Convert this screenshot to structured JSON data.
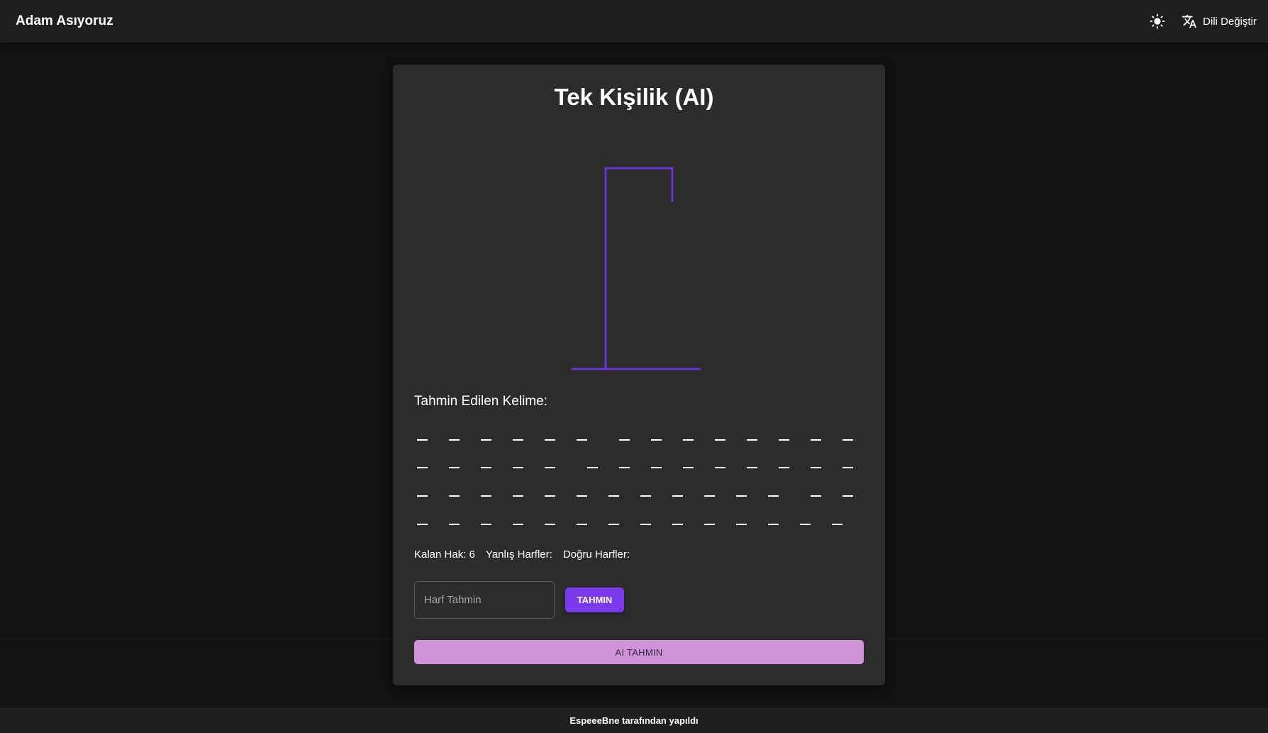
{
  "app": {
    "title": "Adam Asıyoruz"
  },
  "toolbar": {
    "theme_icon": "sun-icon",
    "translate_icon": "translate-icon",
    "language_label": "Dili Değiştir"
  },
  "game": {
    "title": "Tek Kişilik (AI)",
    "word_label": "Tahmin Edilen Kelime:",
    "word_row_dash_counts": [
      14,
      14,
      14,
      14
    ],
    "remaining_label": "Kalan Hak: 6",
    "wrong_label": "Yanlış Harfler:",
    "correct_label": "Doğru Harfler:",
    "input_placeholder": "Harf Tahmin",
    "guess_button": "TAHMIN",
    "ai_button": "AI TAHMIN"
  },
  "colors": {
    "accent": "#7c3aed",
    "gallows": "#6d33d6",
    "ai_button": "#ce93d8",
    "card": "#2c2c2c",
    "background": "#121212"
  },
  "footer": {
    "text": "EspeeeBne tarafından yapıldı"
  }
}
